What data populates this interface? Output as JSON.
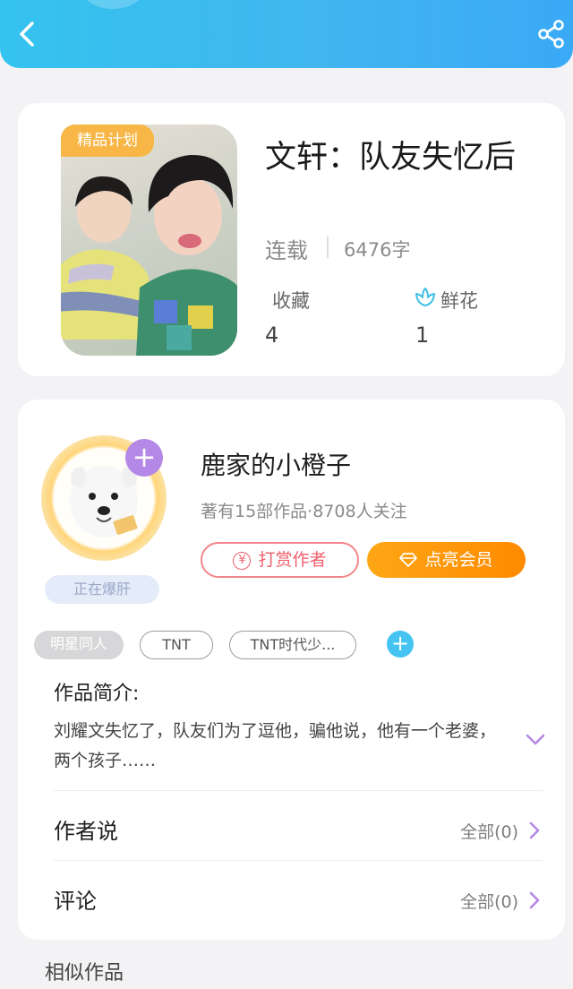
{
  "book": {
    "badge": "精品计划",
    "title": "文轩：队友失忆后",
    "status": "连载",
    "word_count": "6476字",
    "favorites_label": "收藏",
    "favorites_value": "4",
    "flowers_label": "鲜花",
    "flowers_value": "1"
  },
  "author": {
    "name": "鹿家的小橙子",
    "stats": "著有15部作品·8708人关注",
    "busy_badge": "正在爆肝",
    "tip_label": "打赏作者",
    "tip_symbol": "¥",
    "vip_label": "点亮会员",
    "follow_symbol": "+"
  },
  "tags": [
    "明星同人",
    "TNT",
    "TNT时代少..."
  ],
  "tag_add_symbol": "+",
  "intro": {
    "title": "作品简介:",
    "text": "刘耀文失忆了，队友们为了逗他，骗他说，他有一个老婆，两个孩子……"
  },
  "rows": [
    {
      "label": "作者说",
      "count": "全部(0)"
    },
    {
      "label": "评论",
      "count": "全部(0)"
    }
  ],
  "similar_title": "相似作品",
  "colors": {
    "header_start": "#34c3ee",
    "header_end": "#3aa9f6",
    "badge": "#f7b646",
    "tip": "#ef5f6a",
    "vip_start": "#fea614",
    "vip_end": "#ff8a00",
    "accent_purple": "#b488e6",
    "tag_add": "#45c4f2"
  },
  "icons": {
    "back": "back-arrow-icon",
    "share": "share-icon",
    "flower": "flower-icon",
    "expand": "chevron-down-icon",
    "row_arrow": "chevron-right-icon",
    "vip": "diamond-icon"
  }
}
